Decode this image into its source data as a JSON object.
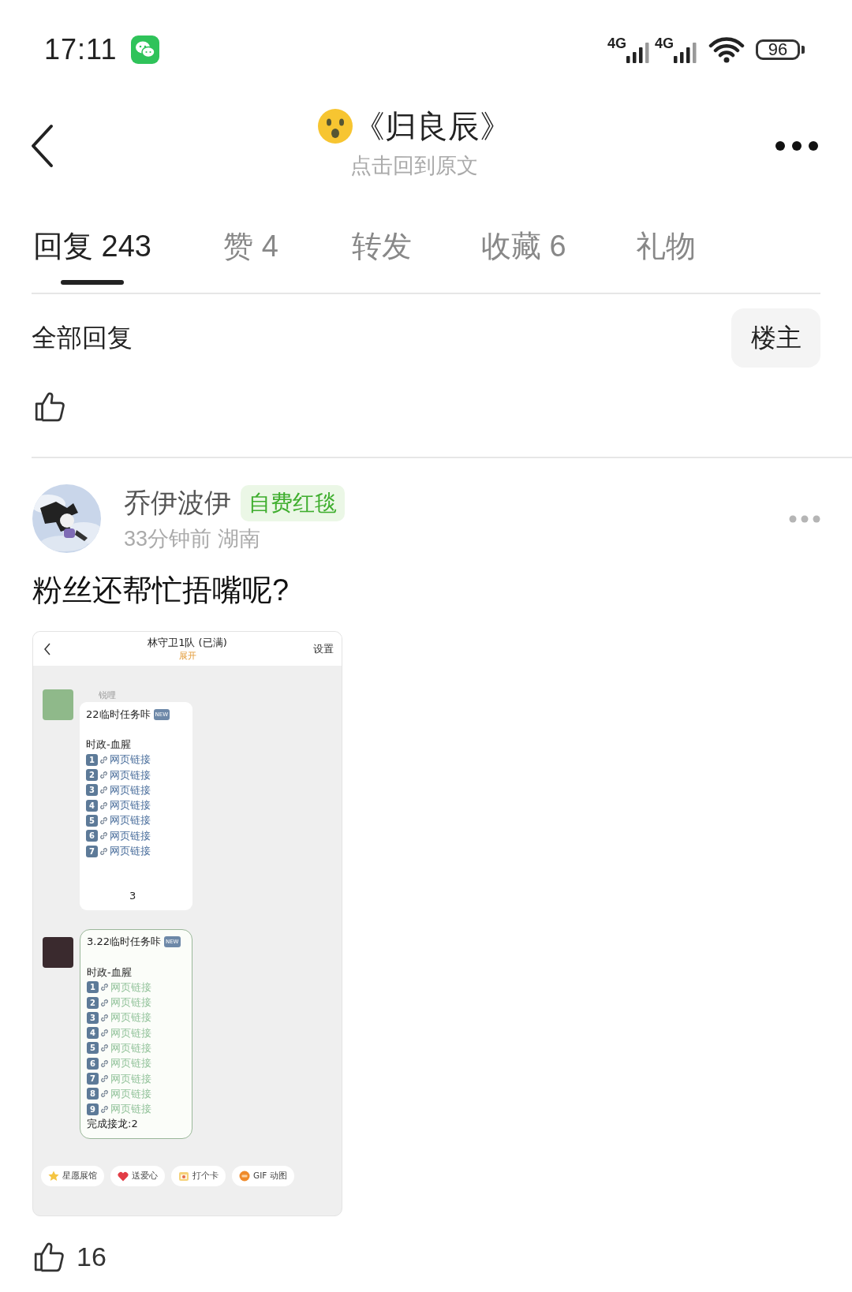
{
  "status_bar": {
    "time": "17:11",
    "network_1": "4G",
    "network_2": "4G",
    "battery": "96"
  },
  "header": {
    "title": "《归良辰》",
    "subtitle": "点击回到原文"
  },
  "tabs": [
    {
      "label": "回复 243",
      "selected": true
    },
    {
      "label": "赞 4",
      "selected": false
    },
    {
      "label": "转发",
      "selected": false
    },
    {
      "label": "收藏 6",
      "selected": false
    },
    {
      "label": "礼物",
      "selected": false
    }
  ],
  "filter": {
    "label": "全部回复",
    "button": "楼主"
  },
  "post": {
    "author": "乔伊波伊",
    "badge": "自费红毯",
    "meta": "33分钟前 湖南",
    "text": "粉丝还帮忙捂嘴呢?",
    "likes": "16",
    "screenshot": {
      "title": "林守卫1队 (已满)",
      "subtitle": "展开",
      "action": "设置",
      "messages": [
        {
          "kind": "plain",
          "sender": "锐哩",
          "heading": "22临时任务咔",
          "badge": "NEW",
          "section": "时政-血腥",
          "links": [
            {
              "number": "1",
              "label": "网页链接"
            },
            {
              "number": "2",
              "label": "网页链接"
            },
            {
              "number": "3",
              "label": "网页链接"
            },
            {
              "number": "4",
              "label": "网页链接"
            },
            {
              "number": "5",
              "label": "网页链接"
            },
            {
              "number": "6",
              "label": "网页链接"
            },
            {
              "number": "7",
              "label": "网页链接"
            }
          ],
          "footer": "3"
        },
        {
          "kind": "framed",
          "heading": "3.22临时任务咔",
          "badge": "NEW",
          "section": "时政-血腥",
          "links": [
            {
              "number": "1",
              "label": "网页链接"
            },
            {
              "number": "2",
              "label": "网页链接"
            },
            {
              "number": "3",
              "label": "网页链接"
            },
            {
              "number": "4",
              "label": "网页链接"
            },
            {
              "number": "5",
              "label": "网页链接"
            },
            {
              "number": "6",
              "label": "网页链接"
            },
            {
              "number": "7",
              "label": "网页链接"
            },
            {
              "number": "8",
              "label": "网页链接"
            },
            {
              "number": "9",
              "label": "网页链接"
            }
          ],
          "footer": "完成接龙:2"
        }
      ],
      "chips": [
        {
          "kind": "star",
          "label": "星愿展馆"
        },
        {
          "kind": "heart",
          "label": "送爱心"
        },
        {
          "kind": "card",
          "label": "打个卡"
        },
        {
          "kind": "gif",
          "label": "GIF 动图"
        }
      ]
    }
  }
}
